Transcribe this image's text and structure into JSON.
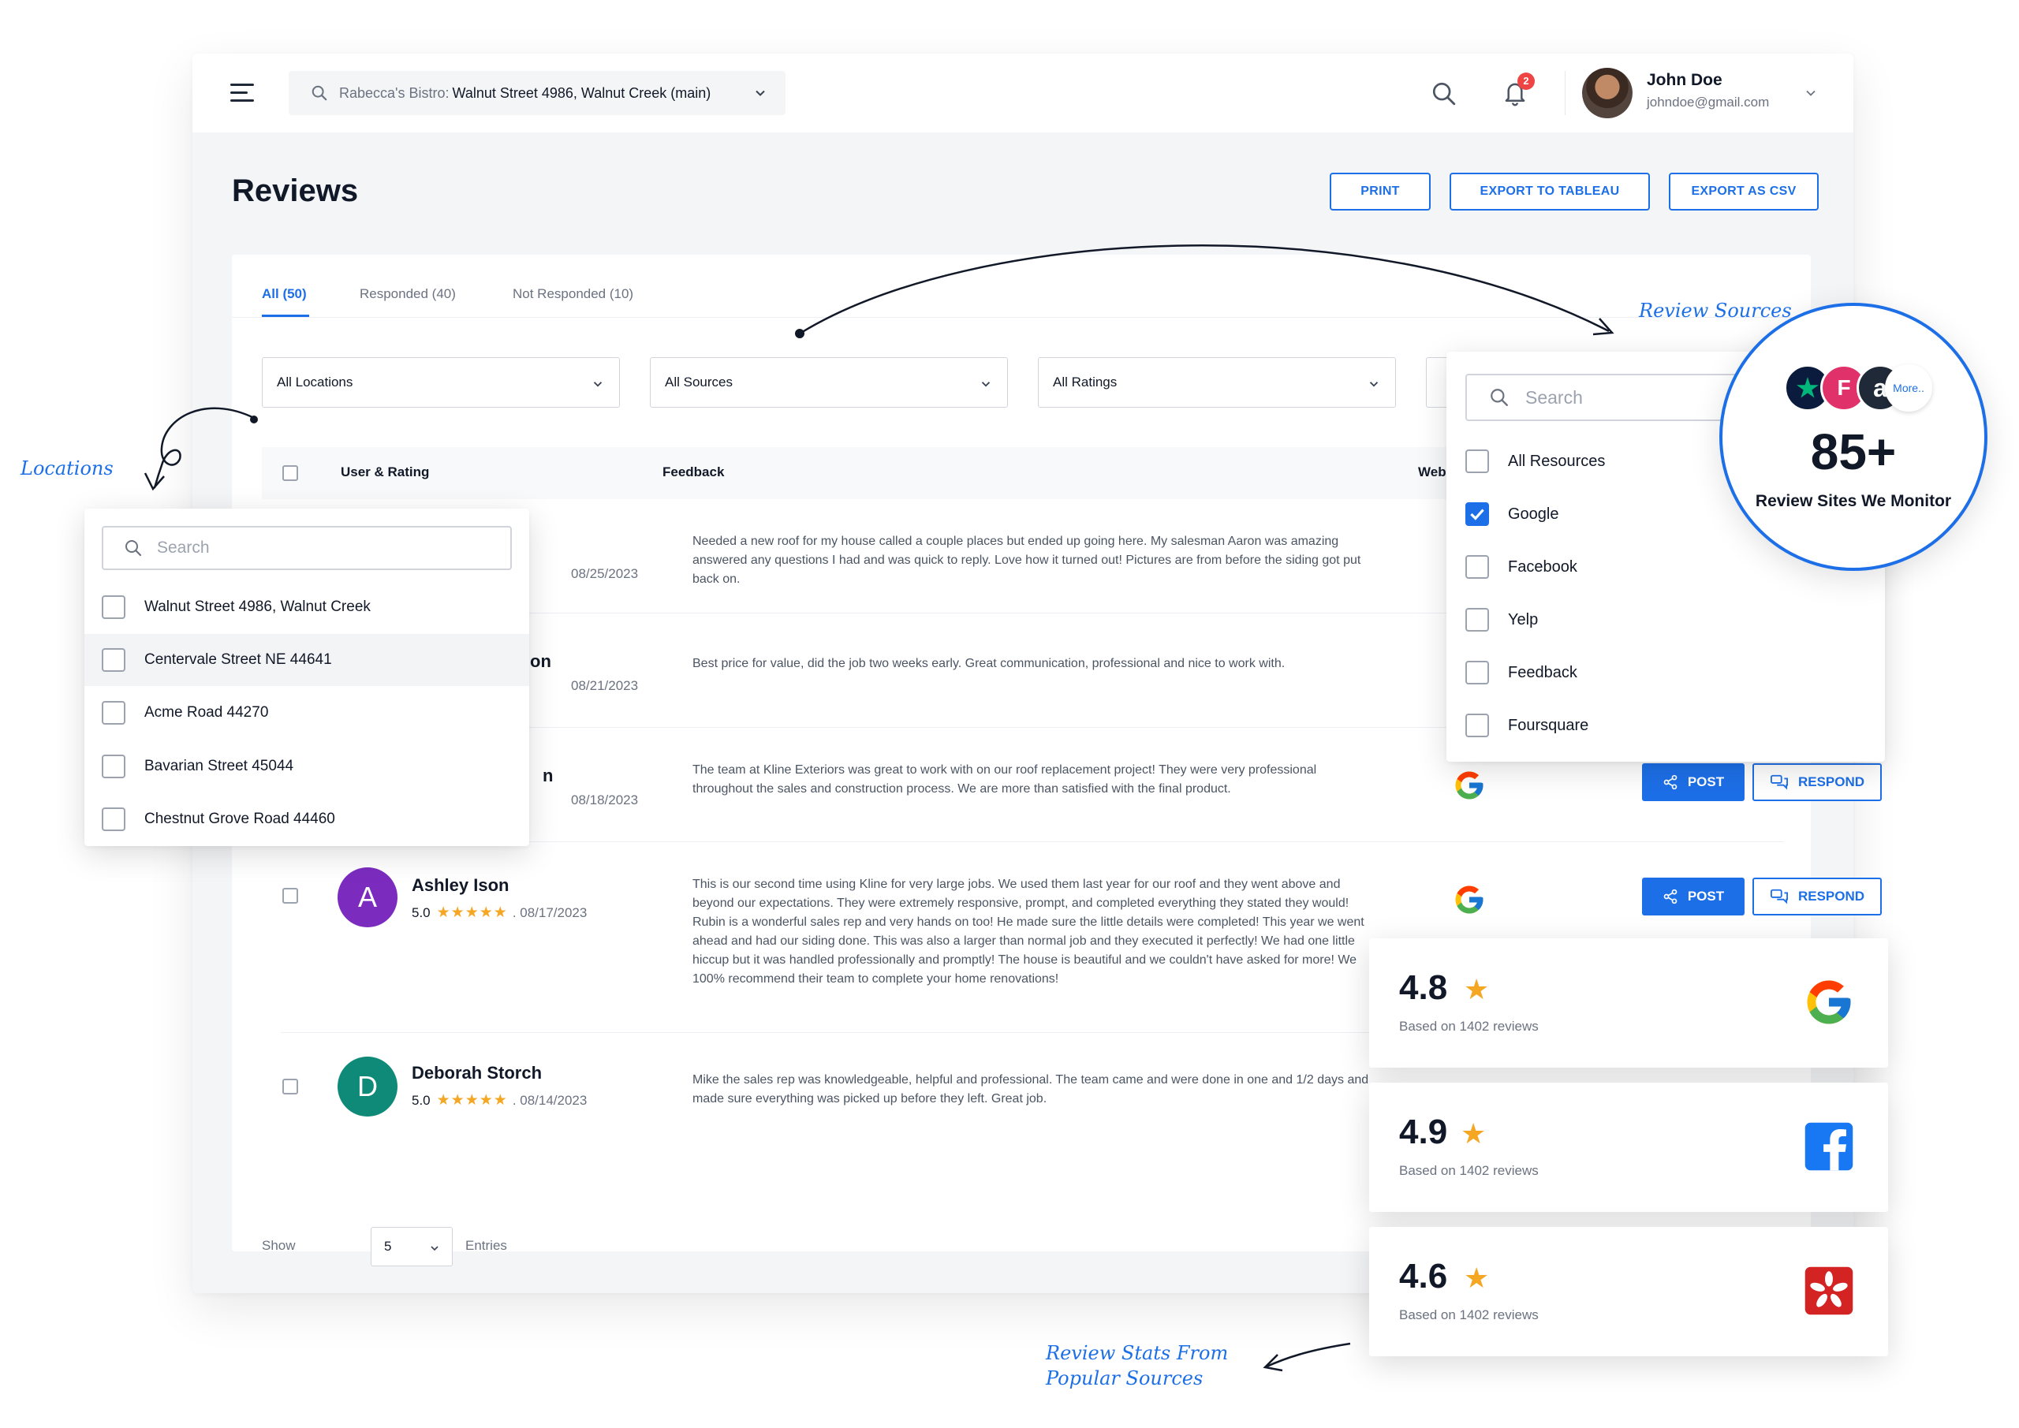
{
  "location_picker": {
    "label": "Rabecca's Bistro:",
    "value": "Walnut Street 4986, Walnut Creek (main)"
  },
  "notifications": {
    "count": "2"
  },
  "user": {
    "name": "John Doe",
    "email": "johndoe@gmail.com"
  },
  "page": {
    "title": "Reviews"
  },
  "actions": {
    "print": "PRINT",
    "export_tableau": "EXPORT TO TABLEAU",
    "export_csv": "EXPORT AS CSV"
  },
  "tabs": [
    {
      "label": "All (50)",
      "active": true
    },
    {
      "label": "Responded (40)",
      "active": false
    },
    {
      "label": "Not Responded (10)",
      "active": false
    }
  ],
  "filters": {
    "locations": "All Locations",
    "sources": "All Sources",
    "ratings": "All Ratings"
  },
  "table": {
    "columns": {
      "user_rating": "User & Rating",
      "feedback": "Feedback",
      "website": "Website"
    },
    "rows": [
      {
        "name": "",
        "initial": "",
        "score": "",
        "date": "08/25/2023",
        "feedback": "Needed a new roof for my house called a couple places but ended up going here. My salesman Aaron was amazing answered any questions I had and was quick to reply. Love how it turned out! Pictures are from before the siding got put back on.",
        "website": "google-icon"
      },
      {
        "name": "on",
        "initial": "",
        "score": "",
        "date": "08/21/2023",
        "feedback": "Best price for value, did the job two weeks early. Great communication, professional and nice to work with.",
        "website": "google-icon"
      },
      {
        "name": "n",
        "initial": "",
        "score": "",
        "date": "08/18/2023",
        "feedback": "The team at Kline Exteriors was great to work with on our roof replacement project! They were very professional throughout the sales and construction process. We are more than satisfied with the final product.",
        "website": "google-icon"
      },
      {
        "name": "Ashley Ison",
        "initial": "A",
        "score": "5.0",
        "date": ". 08/17/2023",
        "feedback": "This is our second time using Kline for very large jobs. We used them last year for our roof and they went above and beyond our expectations. They were extremely responsive, prompt, and completed everything they stated they would! Rubin is a wonderful sales rep and very hands on too! He made sure the little details were completed! This year we went ahead and had our siding done. This was also a larger than normal job and they executed it perfectly! We had one little hiccup but it was handled professionally and promptly! The house is beautiful and we couldn't have asked for more! We 100% recommend their team to complete your home renovations!",
        "website": "google-icon",
        "avatar_color": "#7b2cbf"
      },
      {
        "name": "Deborah Storch",
        "initial": "D",
        "score": "5.0",
        "date": ". 08/14/2023",
        "feedback": "Mike the sales rep was knowledgeable, helpful and professional. The team came and were done in one and 1/2 days and made sure everything was picked up before they left. Great job.",
        "website": "google-icon",
        "avatar_color": "#0f8a78"
      }
    ],
    "row_actions": {
      "post": "POST",
      "respond": "RESPOND"
    }
  },
  "pagination": {
    "show": "Show",
    "entries_value": "5",
    "entries": "Entries"
  },
  "locations_dropdown": {
    "search_placeholder": "Search",
    "options": [
      "Walnut Street 4986, Walnut Creek",
      "Centervale Street NE 44641",
      "Acme Road 44270",
      "Bavarian Street 45044",
      "Chestnut Grove Road 44460"
    ]
  },
  "sources_dropdown": {
    "search_placeholder": "Search",
    "options": [
      {
        "label": "All Resources",
        "checked": false
      },
      {
        "label": "Google",
        "checked": true
      },
      {
        "label": "Facebook",
        "checked": false
      },
      {
        "label": "Yelp",
        "checked": false
      },
      {
        "label": "Feedback",
        "checked": false
      },
      {
        "label": "Foursquare",
        "checked": false
      }
    ]
  },
  "sources_bubble": {
    "more": "More..",
    "count": "85+",
    "caption": "Review Sites We Monitor"
  },
  "stats": [
    {
      "value": "4.8",
      "based_on": "Based on 1402 reviews",
      "source": "google-icon"
    },
    {
      "value": "4.9",
      "based_on": "Based on 1402 reviews",
      "source": "facebook-icon"
    },
    {
      "value": "4.6",
      "based_on": "Based on 1402 reviews",
      "source": "yelp-icon"
    }
  ],
  "annotations": {
    "locations": "Locations",
    "review_sources": "Review Sources",
    "stats_line1": "Review Stats From",
    "stats_line2": "Popular Sources"
  },
  "colors": {
    "accent": "#1d6fe8",
    "star": "#f5a623",
    "badge": "#ef4444"
  }
}
